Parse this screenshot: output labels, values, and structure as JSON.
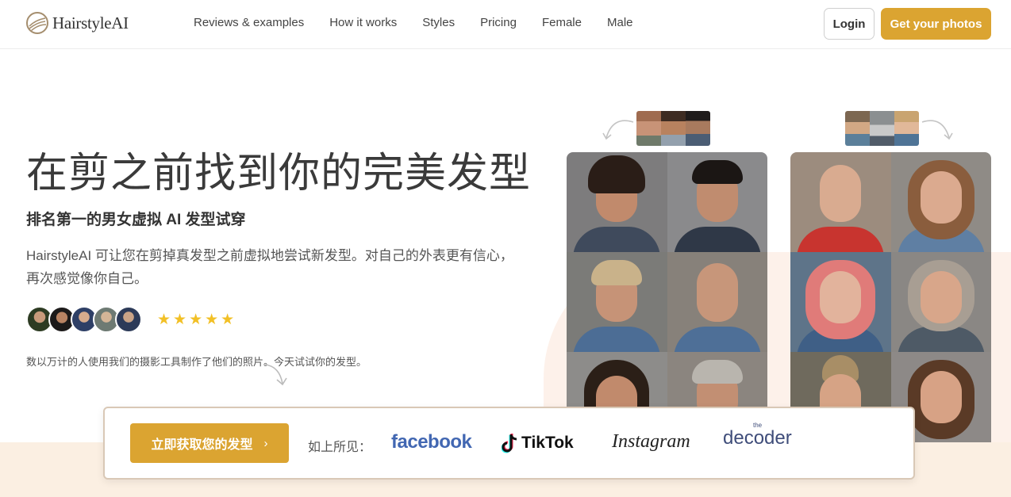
{
  "brand": {
    "name": "HairstyleAI"
  },
  "nav": {
    "links": [
      "Reviews & examples",
      "How it works",
      "Styles",
      "Pricing",
      "Female",
      "Male"
    ],
    "login": "Login",
    "cta": "Get your photos"
  },
  "hero": {
    "title": "在剪之前找到你的完美发型",
    "subtitle": "排名第一的男女虚拟 AI 发型试穿",
    "description": "HairstyleAI 可让您在剪掉真发型之前虚拟地尝试新发型。对自己的外表更有信心，再次感觉像你自己。",
    "stars": "★★★★★",
    "rating": 5,
    "users_note": "数以万计的人使用我们的摄影工具制作了他们的照片。今天试试你的发型。"
  },
  "cta_bar": {
    "button": "立即获取您的发型",
    "chevron": "›",
    "seen_on": "如上所见：",
    "brands": {
      "facebook": "facebook",
      "tiktok": "TikTok",
      "instagram": "Instagram",
      "decoder": "decoder",
      "decoder_prefix": "the"
    }
  },
  "colors": {
    "accent": "#dba431",
    "peach": "#fdf1ea",
    "band": "#fbefe2",
    "facebook": "#4267b2",
    "star": "#f2c026"
  }
}
